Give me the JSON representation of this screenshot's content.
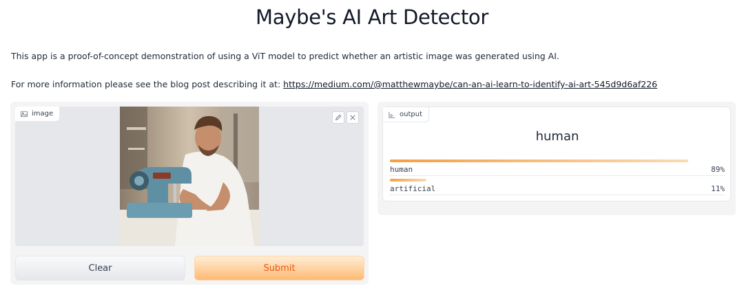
{
  "title": "Maybe's AI Art Detector",
  "description": "This app is a proof-of-concept demonstration of using a ViT model to predict whether an artistic image was generated using AI.",
  "more_info": {
    "prefix": "For more information please see the blog post describing it at: ",
    "link": "https://medium.com/@matthewmaybe/can-an-ai-learn-to-identify-ai-art-545d9d6af226"
  },
  "input": {
    "label": "image",
    "label_icon": "image-icon",
    "edit_icon": "pencil-icon",
    "close_icon": "close-icon"
  },
  "buttons": {
    "clear": "Clear",
    "submit": "Submit"
  },
  "output": {
    "label": "output",
    "label_icon": "bar-chart-icon",
    "top_label": "human",
    "confidences": [
      {
        "label": "human",
        "value": 0.89,
        "display": "89%"
      },
      {
        "label": "artificial",
        "value": 0.11,
        "display": "11%"
      }
    ]
  },
  "colors": {
    "submit_text": "#ea580c",
    "bar_start": "#f59e42",
    "bar_end": "#fcd9b3"
  }
}
